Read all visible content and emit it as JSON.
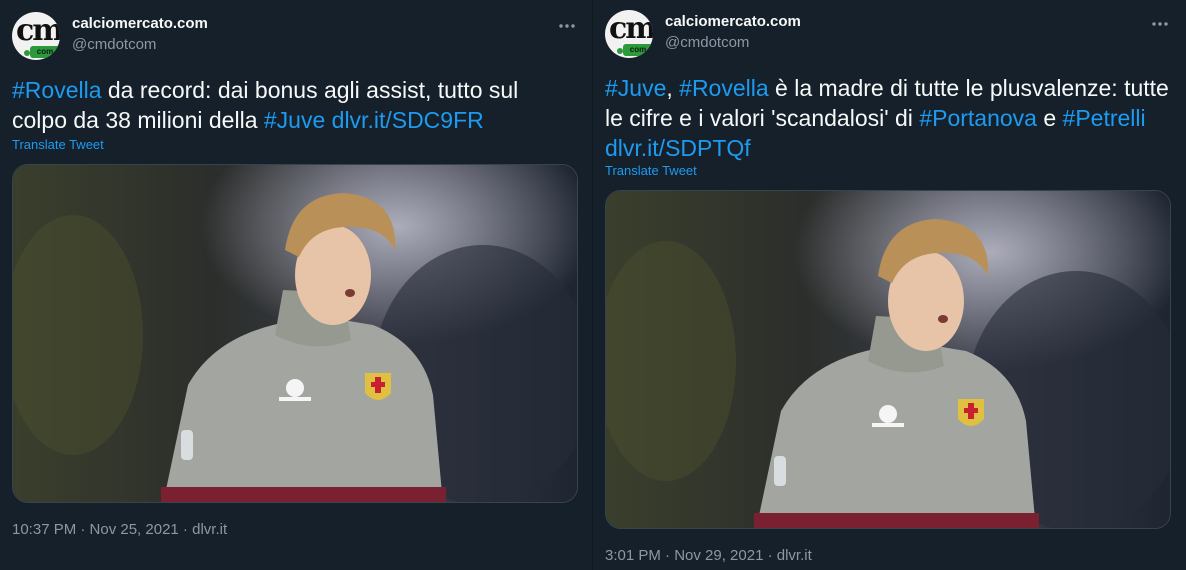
{
  "tweets": [
    {
      "author": {
        "name": "calciomercato.com",
        "handle": "@cmdotcom",
        "avatar_text": "cm",
        "avatar_badge": "com"
      },
      "text_lines": [
        [
          {
            "t": "#Rovella",
            "hl": true
          },
          {
            "t": " da record: dai bonus agli assist, tutto sul",
            "hl": false
          }
        ],
        [
          {
            "t": "colpo da 38 milioni della ",
            "hl": false
          },
          {
            "t": "#Juve",
            "hl": true
          },
          {
            "t": " ",
            "hl": false
          },
          {
            "t": "dlvr.it/SDC9FR",
            "hl": true
          }
        ]
      ],
      "translate": "Translate Tweet",
      "image": {
        "alt": "Player in grey goalkeeper kit",
        "brand_icon": "kappa-logo",
        "crest_icon": "genoa-crest"
      },
      "timestamp": "10:37 PM · Nov 25, 2021 · dlvr.it"
    },
    {
      "author": {
        "name": "calciomercato.com",
        "handle": "@cmdotcom",
        "avatar_text": "cm",
        "avatar_badge": "com"
      },
      "text_lines": [
        [
          {
            "t": "#Juve",
            "hl": true
          },
          {
            "t": ", ",
            "hl": false
          },
          {
            "t": "#Rovella",
            "hl": true
          },
          {
            "t": " è la madre di tutte le plusvalenze: tutte",
            "hl": false
          }
        ],
        [
          {
            "t": "le cifre e i valori 'scandalosi' di ",
            "hl": false
          },
          {
            "t": "#Portanova",
            "hl": true
          },
          {
            "t": " e ",
            "hl": false
          },
          {
            "t": "#Petrelli",
            "hl": true
          }
        ],
        [
          {
            "t": "dlvr.it/SDPTQf",
            "hl": true
          }
        ]
      ],
      "translate": "Translate Tweet",
      "image": {
        "alt": "Player in grey goalkeeper kit",
        "brand_icon": "kappa-logo",
        "crest_icon": "genoa-crest"
      },
      "timestamp": "3:01 PM · Nov 29, 2021 · dlvr.it"
    }
  ],
  "colors": {
    "background": "#15202b",
    "link": "#1d9bf0",
    "secondary": "#8b98a5",
    "text": "#f7f9f9",
    "border": "#38444d"
  }
}
